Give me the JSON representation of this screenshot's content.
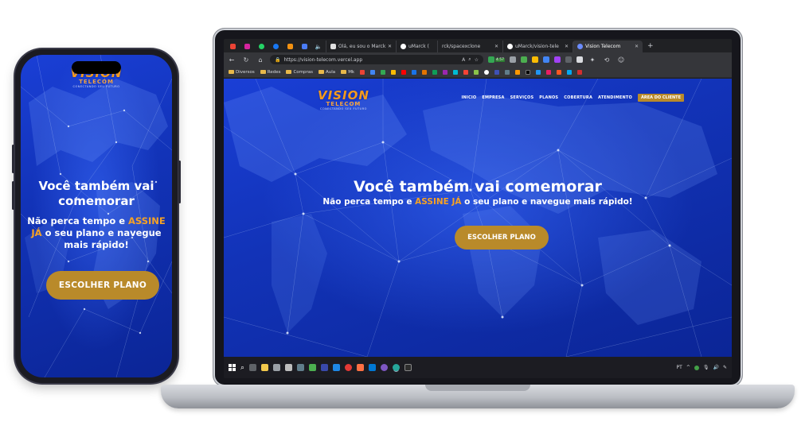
{
  "brand": {
    "logo_main": "VISION",
    "logo_sub": "TELECOM",
    "logo_tagline": "CONECTANDO SEU FUTURO"
  },
  "hero": {
    "heading": "Você também vai comemorar",
    "sub_before": "Não perca tempo e ",
    "sub_accent": "ASSINE JÁ",
    "sub_after": " o seu plano e navegue mais rápido!",
    "cta": "ESCOLHER PLANO"
  },
  "phone": {
    "heading": "Você também vai comemorar",
    "sub_before": "Não perca tempo e ",
    "sub_accent": "ASSINE JÁ",
    "sub_after": " o seu plano e navegue mais rápido!",
    "cta": "ESCOLHER PLANO"
  },
  "browser": {
    "tabs": [
      {
        "label": "Olá, eu sou o Marck",
        "icon": "document-icon"
      },
      {
        "label": "uMarck (",
        "icon": "github-icon"
      },
      {
        "label": "rck/spacexclone",
        "icon": "github-icon"
      },
      {
        "label": "uMarck/vision-tele",
        "icon": "github-icon"
      },
      {
        "label": "Vision Telecom",
        "icon": "globe-icon",
        "active": true
      }
    ],
    "url": "https://vision-telecom.vercel.app",
    "bookmarks": [
      "Diversos",
      "Redes",
      "Compras",
      "Aula",
      "Mk"
    ],
    "ext_badge": "4.57"
  },
  "site_nav": {
    "items": [
      "INICIO",
      "EMPRESA",
      "SERVIÇOS",
      "PLANOS",
      "COBERTURA",
      "ATENDIMENTO"
    ],
    "cta": "ÁREA DO CLIENTE"
  },
  "taskbar": {
    "lang": "PT"
  },
  "colors": {
    "hero_blue": "#1233b8",
    "accent_orange": "#f6a224",
    "button_gold": "#b98a2a"
  }
}
